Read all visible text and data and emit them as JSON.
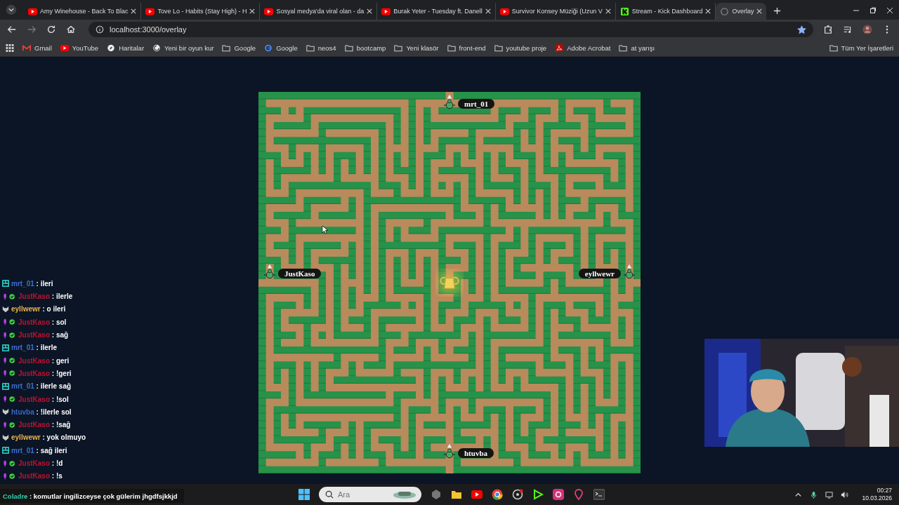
{
  "tabs": [
    {
      "title": "Amy Winehouse - Back To Blac",
      "kind": "youtube",
      "selected": false
    },
    {
      "title": "Tove Lo - Habits (Stay High) - H",
      "kind": "youtube",
      "selected": false
    },
    {
      "title": "Sosyal medya'da viral olan - da",
      "kind": "youtube",
      "selected": false
    },
    {
      "title": "Burak Yeter - Tuesday ft. Danell",
      "kind": "youtube",
      "selected": false
    },
    {
      "title": "Survivor Konsey Müziği (Uzun V",
      "kind": "youtube",
      "selected": false
    },
    {
      "title": "Stream - Kick Dashboard",
      "kind": "kick",
      "selected": false
    },
    {
      "title": "Overlay",
      "kind": "page",
      "selected": true
    }
  ],
  "address_bar": {
    "url": "localhost:3000/overlay",
    "bookmarked": true
  },
  "bookmarks": [
    {
      "label": "Gmail",
      "kind": "gmail"
    },
    {
      "label": "YouTube",
      "kind": "youtube"
    },
    {
      "label": "Haritalar",
      "kind": "maps"
    },
    {
      "label": "Yeni bir oyun kur",
      "kind": "game"
    },
    {
      "label": "Google",
      "kind": "folder"
    },
    {
      "label": "Google",
      "kind": "google"
    },
    {
      "label": "neos4",
      "kind": "folder"
    },
    {
      "label": "bootcamp",
      "kind": "folder"
    },
    {
      "label": "Yeni klasör",
      "kind": "folder"
    },
    {
      "label": "front-end",
      "kind": "folder"
    },
    {
      "label": "youtube proje",
      "kind": "folder"
    },
    {
      "label": "Adobe Acrobat",
      "kind": "pdf"
    },
    {
      "label": "at yarışı",
      "kind": "folder"
    }
  ],
  "all_bookmarks": "Tüm Yer İşaretleri",
  "maze": {
    "players": [
      {
        "name": "mrt_01",
        "kind": "top"
      },
      {
        "name": "JustKaso",
        "kind": "left"
      },
      {
        "name": "eyllwewr",
        "kind": "right"
      },
      {
        "name": "htuvba",
        "kind": "bottom"
      }
    ]
  },
  "chat": [
    {
      "user": "mrt_01",
      "color": "#3d6fd1",
      "kind": "tier",
      "text": ": ileri"
    },
    {
      "user": "JustKaso",
      "color": "#c0122f",
      "kind": "mic",
      "text": ": ilerle"
    },
    {
      "user": "eyllwewr",
      "color": "#e9b24c",
      "kind": "wolf",
      "text": ": o ileri"
    },
    {
      "user": "JustKaso",
      "color": "#c0122f",
      "kind": "mic",
      "text": ": sol"
    },
    {
      "user": "JustKaso",
      "color": "#c0122f",
      "kind": "mic",
      "text": ": sağ"
    },
    {
      "user": "mrt_01",
      "color": "#3d6fd1",
      "kind": "tier",
      "text": ": ilerle"
    },
    {
      "user": "JustKaso",
      "color": "#c0122f",
      "kind": "mic",
      "text": ": geri"
    },
    {
      "user": "JustKaso",
      "color": "#c0122f",
      "kind": "mic",
      "text": ": !geri"
    },
    {
      "user": "mrt_01",
      "color": "#3d6fd1",
      "kind": "tier",
      "text": ": ilerle sağ"
    },
    {
      "user": "JustKaso",
      "color": "#c0122f",
      "kind": "mic",
      "text": ": !sol"
    },
    {
      "user": "htuvba",
      "color": "#3a66c4",
      "kind": "wolf",
      "text": ": !ilerle sol"
    },
    {
      "user": "JustKaso",
      "color": "#c0122f",
      "kind": "mic",
      "text": ": !sağ"
    },
    {
      "user": "eyllwewr",
      "color": "#e9b24c",
      "kind": "wolf",
      "text": ": yok olmuyo"
    },
    {
      "user": "mrt_01",
      "color": "#3d6fd1",
      "kind": "tier",
      "text": ": sağ ileri"
    },
    {
      "user": "JustKaso",
      "color": "#c0122f",
      "kind": "mic",
      "text": ": !d"
    },
    {
      "user": "JustKaso",
      "color": "#c0122f",
      "kind": "mic",
      "text": ": !s"
    }
  ],
  "pinned_message": {
    "user": "Coladre",
    "color": "#2fd3b0",
    "text": ": komutlar ingilizceyse çok gülerim jhgdfsjkkjd"
  },
  "taskbar": {
    "search_placeholder": "Ara",
    "time": "00:27",
    "date": "10.03.2026"
  }
}
